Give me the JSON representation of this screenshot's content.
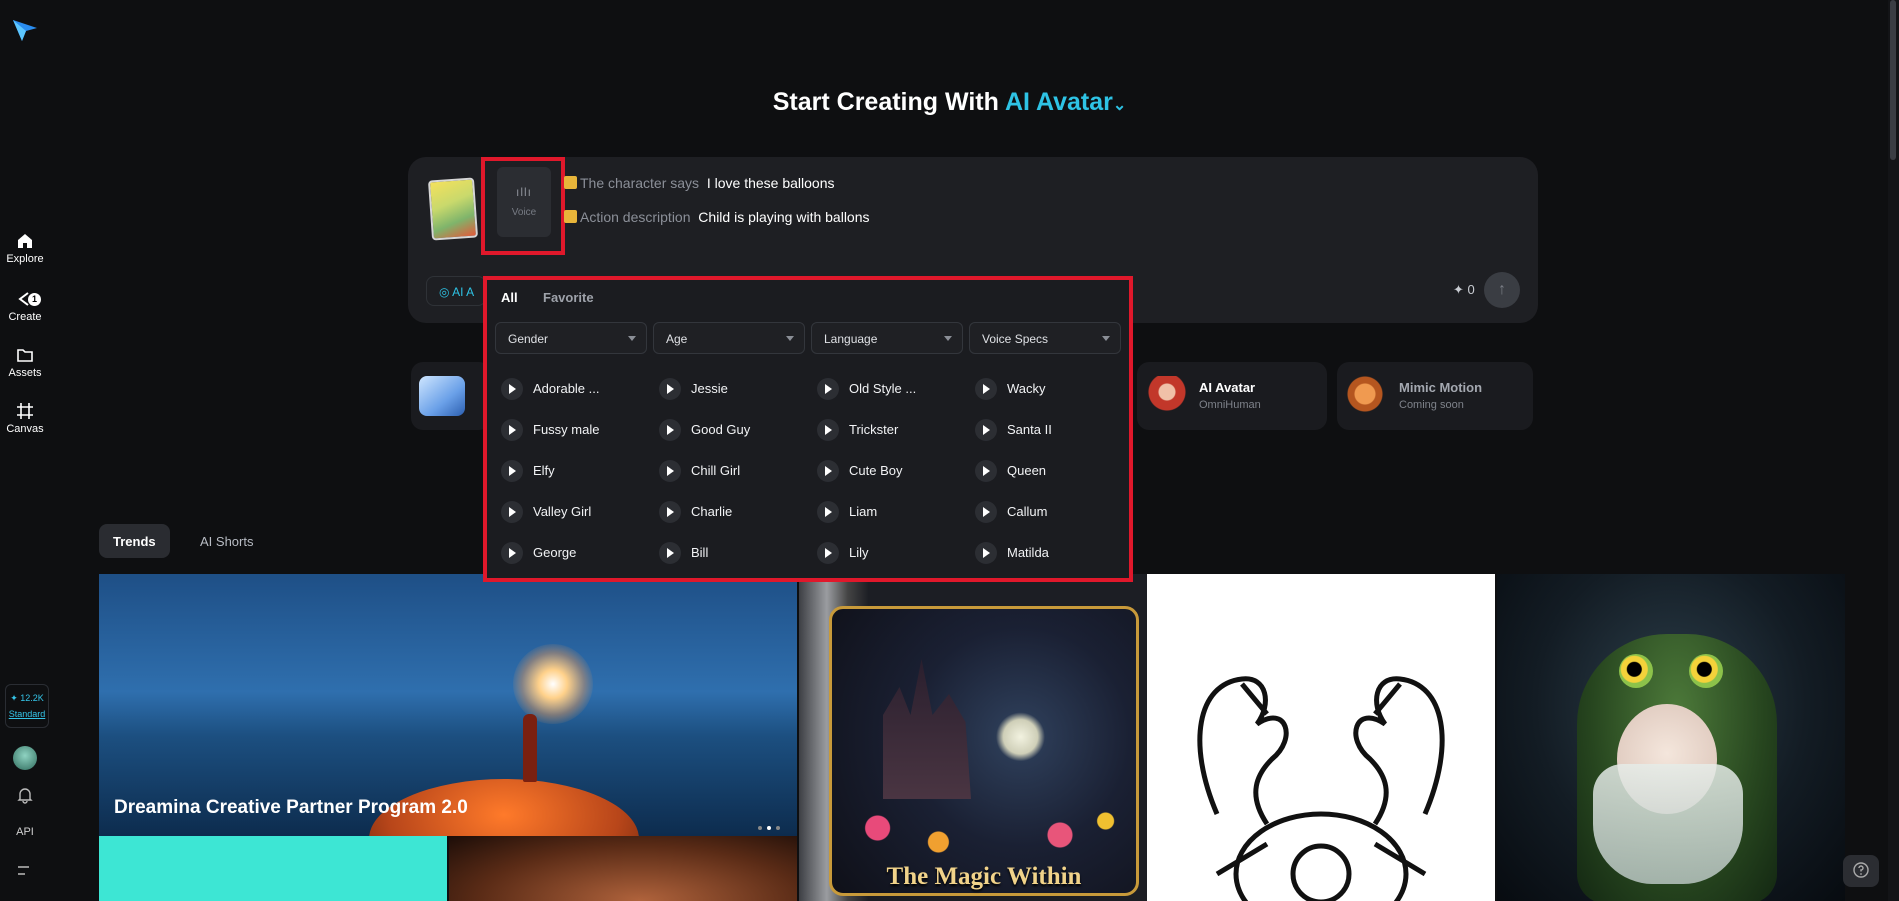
{
  "sidebar": {
    "items": [
      {
        "label": "Explore",
        "icon": "home-icon"
      },
      {
        "label": "Create",
        "icon": "create-icon",
        "badge": "1"
      },
      {
        "label": "Assets",
        "icon": "folder-icon"
      },
      {
        "label": "Canvas",
        "icon": "canvas-icon"
      }
    ],
    "credits": "✦ 12.2K",
    "tier": "Standard",
    "api": "API"
  },
  "header": {
    "prefix": "Start Creating With",
    "mode": "AI Avatar"
  },
  "composer": {
    "voice_label": "Voice",
    "says_tag": "The character says",
    "says_value": "I love these balloons",
    "action_tag": "Action description",
    "action_value": "Child is playing with ballons",
    "mode_pill": "AI A",
    "cost": "✦ 0"
  },
  "voice_panel": {
    "tabs": [
      "All",
      "Favorite"
    ],
    "filters": [
      "Gender",
      "Age",
      "Language",
      "Voice Specs"
    ],
    "voices": [
      "Adorable ...",
      "Jessie",
      "Old Style ...",
      "Wacky",
      "Fussy male",
      "Good Guy",
      "Trickster",
      "Santa II",
      "Elfy",
      "Chill Girl",
      "Cute Boy",
      "Queen",
      "Valley Girl",
      "Charlie",
      "Liam",
      "Callum",
      "George",
      "Bill",
      "Lily",
      "Matilda"
    ]
  },
  "model_cards": {
    "avatar_title": "AI Avatar",
    "avatar_sub": "OmniHuman",
    "mimic_title": "Mimic Motion",
    "mimic_sub": "Coming soon"
  },
  "trends": {
    "tabs": [
      "Trends",
      "AI Shorts"
    ],
    "hero_title": "Dreamina Creative Partner Program 2.0",
    "magic_text": "The Magic Within"
  },
  "colors": {
    "accent": "#2ec3e5",
    "highlight": "#e0182b",
    "background": "#0e0f11"
  }
}
